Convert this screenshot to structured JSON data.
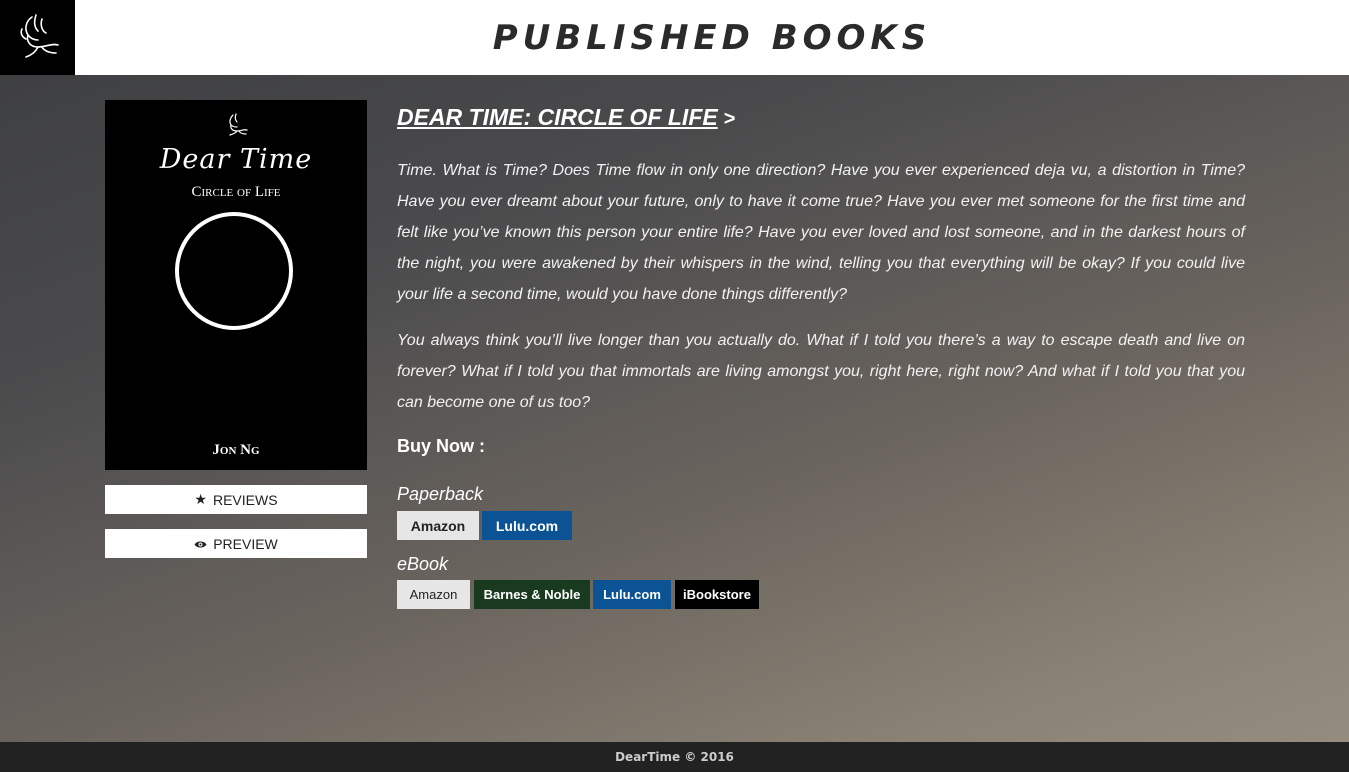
{
  "header": {
    "title": "PUBLISHED BOOKS",
    "logo_icon": "dove-icon"
  },
  "book": {
    "cover": {
      "title": "Dear Time",
      "subtitle": "Circle of Life",
      "author": "Jon Ng"
    },
    "reviews_label": "REVIEWS",
    "preview_label": "PREVIEW",
    "title": "DEAR TIME: CIRCLE OF LIFE",
    "title_arrow": ">",
    "paragraph1": "Time. What is Time? Does Time flow in only one direction? Have you ever experienced deja vu, a distortion in Time? Have you ever dreamt about your future, only to have it come true? Have you ever met someone for the first time and felt like you’ve known this person your entire life? Have you ever loved and lost someone, and in the darkest hours of the night, you were awakened by their whispers in the wind, telling you that everything will be okay? If you could live your life a second time, would you have done things differently?",
    "paragraph2": "You always think you’ll live longer than you actually do. What if I told you there’s a way to escape death and live on forever? What if I told you that immortals are living amongst you, right here, right now? And what if I told you that you can become one of us too?"
  },
  "buy": {
    "label": "Buy Now :",
    "paperback": {
      "label": "Paperback",
      "stores": [
        "Amazon",
        "Lulu.com"
      ]
    },
    "ebook": {
      "label": "eBook",
      "stores": [
        "Amazon",
        "Barnes & Noble",
        "Lulu.com",
        "iBookstore"
      ]
    }
  },
  "colors": {
    "amazon_bg": "#e6e6e6",
    "lulu_bg": "#0b5394",
    "bn_bg": "#1a3a1f",
    "ibookstore_bg": "#000000"
  },
  "footer": {
    "text": "DearTime © 2016"
  }
}
